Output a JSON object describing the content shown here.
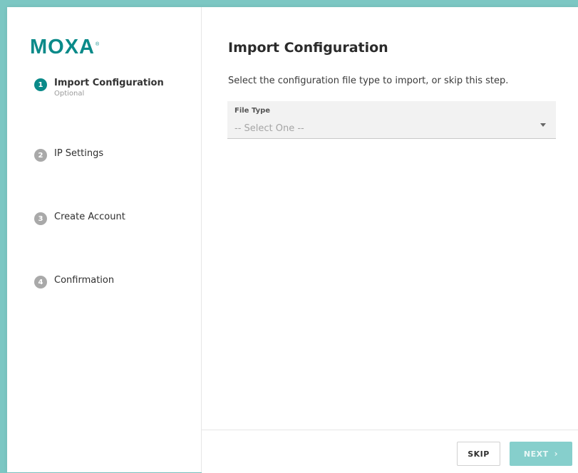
{
  "brand": {
    "logo_text": "MOXA",
    "logo_mark": "®"
  },
  "steps": [
    {
      "number": "1",
      "label": "Import Configuration",
      "sublabel": "Optional",
      "active": true
    },
    {
      "number": "2",
      "label": "IP Settings"
    },
    {
      "number": "3",
      "label": "Create Account"
    },
    {
      "number": "4",
      "label": "Confirmation"
    }
  ],
  "main": {
    "title": "Import Configuration",
    "instruction": "Select the configuration file type to import, or skip this step.",
    "file_type": {
      "label": "File Type",
      "placeholder": "-- Select One --",
      "icon": "chevron-down-icon"
    }
  },
  "footer": {
    "skip_label": "SKIP",
    "next_label": "NEXT",
    "next_icon": "›"
  },
  "colors": {
    "accent": "#0a8a89",
    "next_button_disabled": "#86cfcc",
    "inactive_step": "#a9a9a9",
    "window_backdrop": "#7cc7c3"
  }
}
